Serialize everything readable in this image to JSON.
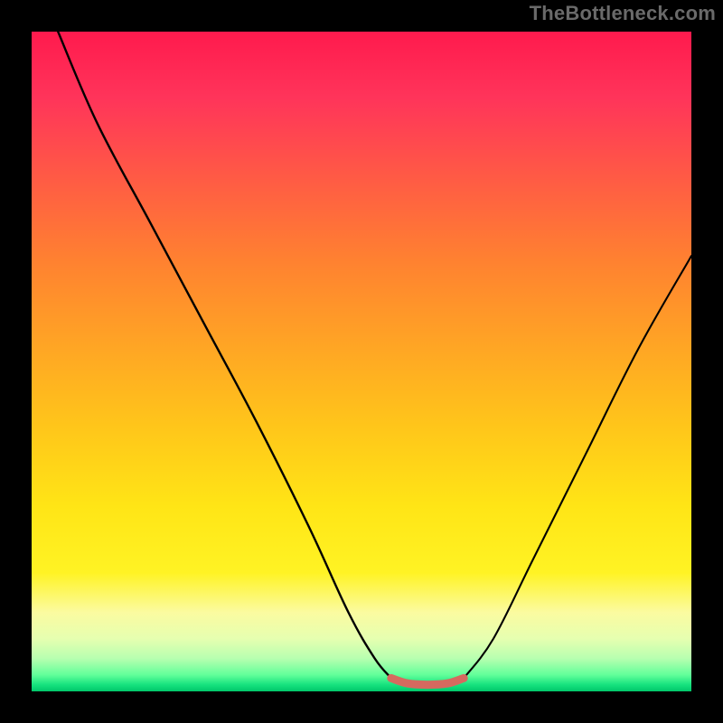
{
  "attribution": "TheBottleneck.com",
  "colors": {
    "gradient_top": "#ff1a4d",
    "gradient_mid": "#ffd000",
    "gradient_bottom": "#00c76a",
    "curve_stroke": "#000000",
    "flat_segment_stroke": "#d6695f",
    "background": "#000000"
  },
  "chart_data": {
    "type": "line",
    "title": "",
    "xlabel": "",
    "ylabel": "",
    "xlim": [
      0,
      100
    ],
    "ylim": [
      0,
      100
    ],
    "series": [
      {
        "name": "left-curve",
        "x": [
          4,
          10,
          18,
          26,
          34,
          42,
          48,
          52,
          54.5
        ],
        "values": [
          100,
          86,
          71,
          56,
          41,
          25,
          12,
          5,
          2
        ]
      },
      {
        "name": "flat-segment",
        "x": [
          54.5,
          57,
          60,
          63,
          65.5
        ],
        "values": [
          2,
          1.2,
          1,
          1.2,
          2
        ]
      },
      {
        "name": "right-curve",
        "x": [
          65.5,
          70,
          76,
          84,
          92,
          100
        ],
        "values": [
          2,
          8,
          20,
          36,
          52,
          66
        ]
      }
    ],
    "annotations": []
  }
}
